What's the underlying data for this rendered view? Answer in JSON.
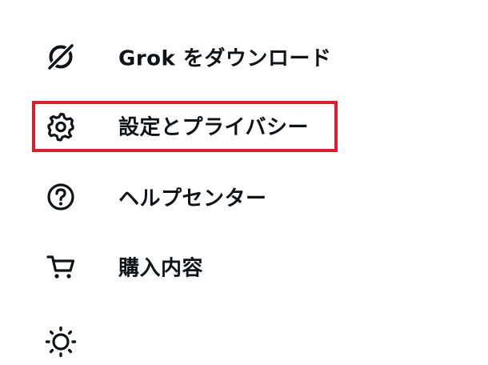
{
  "menu": {
    "items": [
      {
        "label": "Grok をダウンロード",
        "icon": "grok-icon"
      },
      {
        "label": "設定とプライバシー",
        "icon": "gear-icon",
        "highlighted": true
      },
      {
        "label": "ヘルプセンター",
        "icon": "help-circle-icon"
      },
      {
        "label": "購入内容",
        "icon": "cart-icon"
      },
      {
        "label": "",
        "icon": "sun-icon"
      }
    ]
  },
  "colors": {
    "text": "#0f1419",
    "highlight_border": "#d7202f",
    "background": "#ffffff"
  }
}
